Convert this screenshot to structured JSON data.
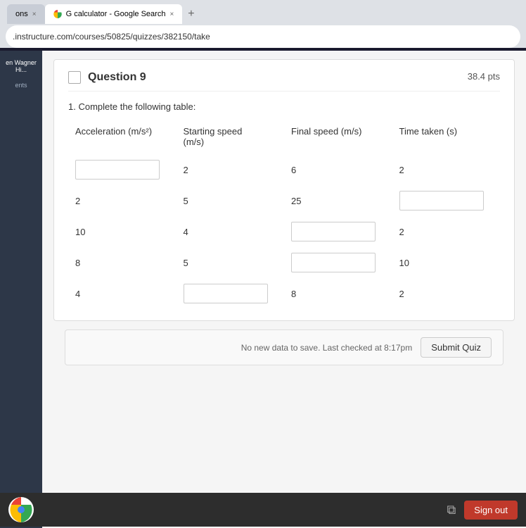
{
  "browser": {
    "tabs": [
      {
        "label": "ons",
        "active": false,
        "id": "tab-1"
      },
      {
        "label": "G  calculator - Google Search",
        "active": true,
        "id": "tab-2"
      }
    ],
    "new_tab_label": "+",
    "address": ".instructure.com/courses/50825/quizzes/382150/take"
  },
  "sidebar": {
    "items": [
      {
        "label": "en Wagner Hi...",
        "active": true
      },
      {
        "label": "ents",
        "active": false
      }
    ]
  },
  "question": {
    "title": "Question 9",
    "pts": "38.4 pts",
    "instruction": "1. Complete the following table:",
    "table": {
      "headers": [
        "Acceleration (m/s²)",
        "Starting speed\n(m/s)",
        "Final speed (m/s)",
        "Time taken (s)"
      ],
      "rows": [
        {
          "acceleration": "",
          "starting_speed": "2",
          "final_speed": "6",
          "time_taken": "2",
          "acc_input": true,
          "ss_input": false,
          "fs_input": false,
          "tt_input": false
        },
        {
          "acceleration": "2",
          "starting_speed": "5",
          "final_speed": "25",
          "time_taken": "",
          "acc_input": false,
          "ss_input": false,
          "fs_input": false,
          "tt_input": true
        },
        {
          "acceleration": "10",
          "starting_speed": "4",
          "final_speed": "",
          "time_taken": "2",
          "acc_input": false,
          "ss_input": false,
          "fs_input": true,
          "tt_input": false
        },
        {
          "acceleration": "8",
          "starting_speed": "5",
          "final_speed": "",
          "time_taken": "10",
          "acc_input": false,
          "ss_input": false,
          "fs_input": true,
          "tt_input": false
        },
        {
          "acceleration": "4",
          "starting_speed": "",
          "final_speed": "8",
          "time_taken": "2",
          "acc_input": false,
          "ss_input": true,
          "fs_input": false,
          "tt_input": false
        }
      ]
    }
  },
  "bottom_bar": {
    "status": "No new data to save. Last checked at 8:17pm",
    "submit_label": "Submit Quiz"
  },
  "taskbar": {
    "sign_out_label": "Sign out"
  }
}
